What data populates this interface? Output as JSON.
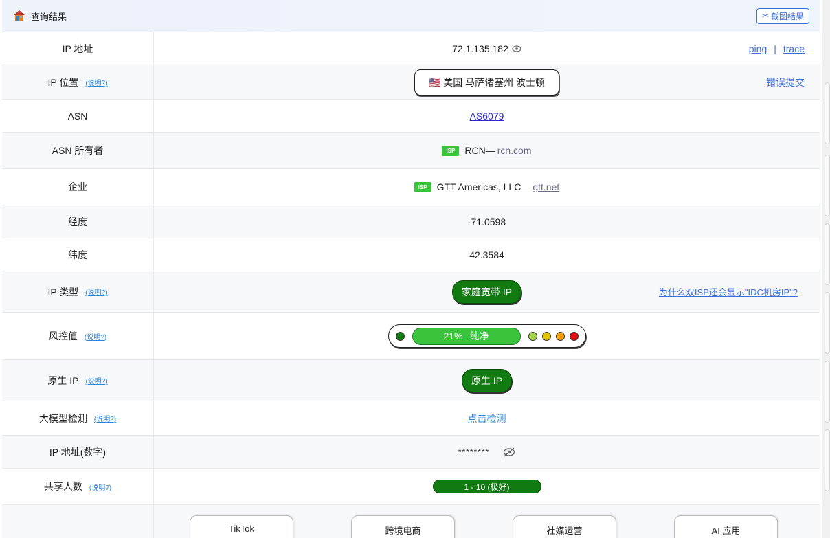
{
  "header": {
    "title": "查询结果",
    "screenshot_button": "截图结果"
  },
  "help_text": "(说明?)",
  "rows": {
    "ip": {
      "label": "IP 地址",
      "value": "72.1.135.182",
      "ping": "ping",
      "sep": "|",
      "trace": "trace"
    },
    "location": {
      "label": "IP 位置",
      "flag": "🇺🇸",
      "value": "美国 马萨诸塞州 波士顿",
      "report": "错误提交"
    },
    "asn": {
      "label": "ASN",
      "value": "AS6079"
    },
    "asn_owner": {
      "label": "ASN 所有者",
      "tag": "ISP",
      "name": "RCN—",
      "domain": "rcn.com"
    },
    "company": {
      "label": "企业",
      "tag": "ISP",
      "name": "GTT Americas, LLC—",
      "domain": "gtt.net"
    },
    "longitude": {
      "label": "经度",
      "value": "-71.0598"
    },
    "latitude": {
      "label": "纬度",
      "value": "42.3584"
    },
    "ip_type": {
      "label": "IP 类型",
      "value": "家庭宽带 IP",
      "why_link": "为什么双ISP还会显示\"IDC机房IP\"?"
    },
    "risk": {
      "label": "风控值",
      "percent": "21%",
      "status": "纯净"
    },
    "native": {
      "label": "原生 IP",
      "value": "原生 IP"
    },
    "llm": {
      "label": "大模型检测",
      "value": "点击检测"
    },
    "ip_numeric": {
      "label": "IP 地址(数字)",
      "value": "********"
    },
    "shared": {
      "label": "共享人数",
      "value": "1 - 10 (极好)"
    }
  },
  "use_cases": [
    "TikTok",
    "跨境电商",
    "社媒运营",
    "AI 应用"
  ],
  "colors": {
    "accent": "#3b6fd8",
    "green": "#117a11",
    "bright_green": "#39c43c",
    "risk_dots": [
      "#117a11",
      "#a5d34a",
      "#e0c500",
      "#f29d0b",
      "#e01010"
    ]
  }
}
